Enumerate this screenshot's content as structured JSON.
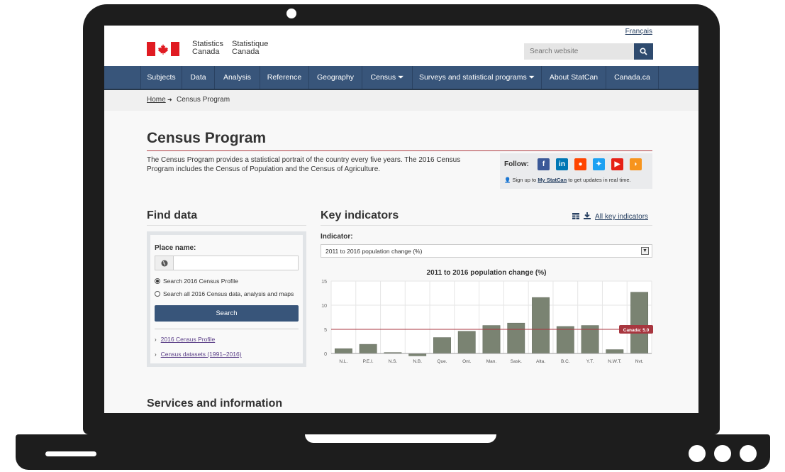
{
  "header": {
    "language_toggle": "Français",
    "wordmark_en_1": "Statistics",
    "wordmark_en_2": "Canada",
    "wordmark_fr_1": "Statistique",
    "wordmark_fr_2": "Canada",
    "search_placeholder": "Search website"
  },
  "nav": {
    "items": [
      {
        "label": "Subjects"
      },
      {
        "label": "Data"
      },
      {
        "label": "Analysis"
      },
      {
        "label": "Reference"
      },
      {
        "label": "Geography"
      },
      {
        "label": "Census ⏷"
      },
      {
        "label": "Surveys and statistical programs ⏷"
      },
      {
        "label": "About StatCan"
      },
      {
        "label": "Canada.ca"
      }
    ]
  },
  "breadcrumb": {
    "home": "Home",
    "separator": "➜",
    "current": "Census Program"
  },
  "main": {
    "title": "Census Program",
    "intro": "The Census Program provides a statistical portrait of the country every five years. The 2016 Census Program includes the Census of Population and the Census of Agriculture."
  },
  "follow": {
    "label": "Follow:",
    "signup_prefix": "Sign up to",
    "signup_link": "My StatCan",
    "signup_suffix": "to get updates in real time.",
    "icons": [
      {
        "name": "facebook-icon",
        "glyph": "f",
        "color": "#3b5998"
      },
      {
        "name": "linkedin-icon",
        "glyph": "in",
        "color": "#0077b5"
      },
      {
        "name": "reddit-icon",
        "glyph": "●",
        "color": "#ff4500"
      },
      {
        "name": "twitter-icon",
        "glyph": "✦",
        "color": "#1da1f2"
      },
      {
        "name": "youtube-icon",
        "glyph": "▶",
        "color": "#e62117"
      },
      {
        "name": "rss-icon",
        "glyph": "◗",
        "color": "#f7941d"
      }
    ]
  },
  "find_data": {
    "heading": "Find data",
    "place_label": "Place name:",
    "place_value": "",
    "radio_profile": "Search 2016 Census Profile",
    "radio_all": "Search all 2016 Census data, analysis and maps",
    "search_button": "Search",
    "link_profile": "2016 Census Profile",
    "link_datasets": "Census datasets (1991–2016)"
  },
  "key_indicators": {
    "heading": "Key indicators",
    "all_link": "All key indicators",
    "indicator_label": "Indicator:",
    "indicator_value": "2011 to 2016 population change (%)"
  },
  "services": {
    "heading": "Services and information"
  },
  "chart_data": {
    "type": "bar",
    "title": "2011 to 2016 population change (%)",
    "categories": [
      "N.L.",
      "P.E.I.",
      "N.S.",
      "N.B.",
      "Que.",
      "Ont.",
      "Man.",
      "Sask.",
      "Alta.",
      "B.C.",
      "Y.T.",
      "N.W.T.",
      "Nvt."
    ],
    "values": [
      1.0,
      1.9,
      0.2,
      -0.5,
      3.3,
      4.6,
      5.8,
      6.3,
      11.6,
      5.6,
      5.8,
      0.8,
      12.7
    ],
    "ylim": [
      0,
      15
    ],
    "yticks": [
      0,
      5,
      10,
      15
    ],
    "grid": true,
    "reference_line": {
      "label": "Canada: 5.0",
      "value": 5.0
    },
    "colors": {
      "bar": "#7a8372",
      "reference": "#a8363f"
    }
  }
}
